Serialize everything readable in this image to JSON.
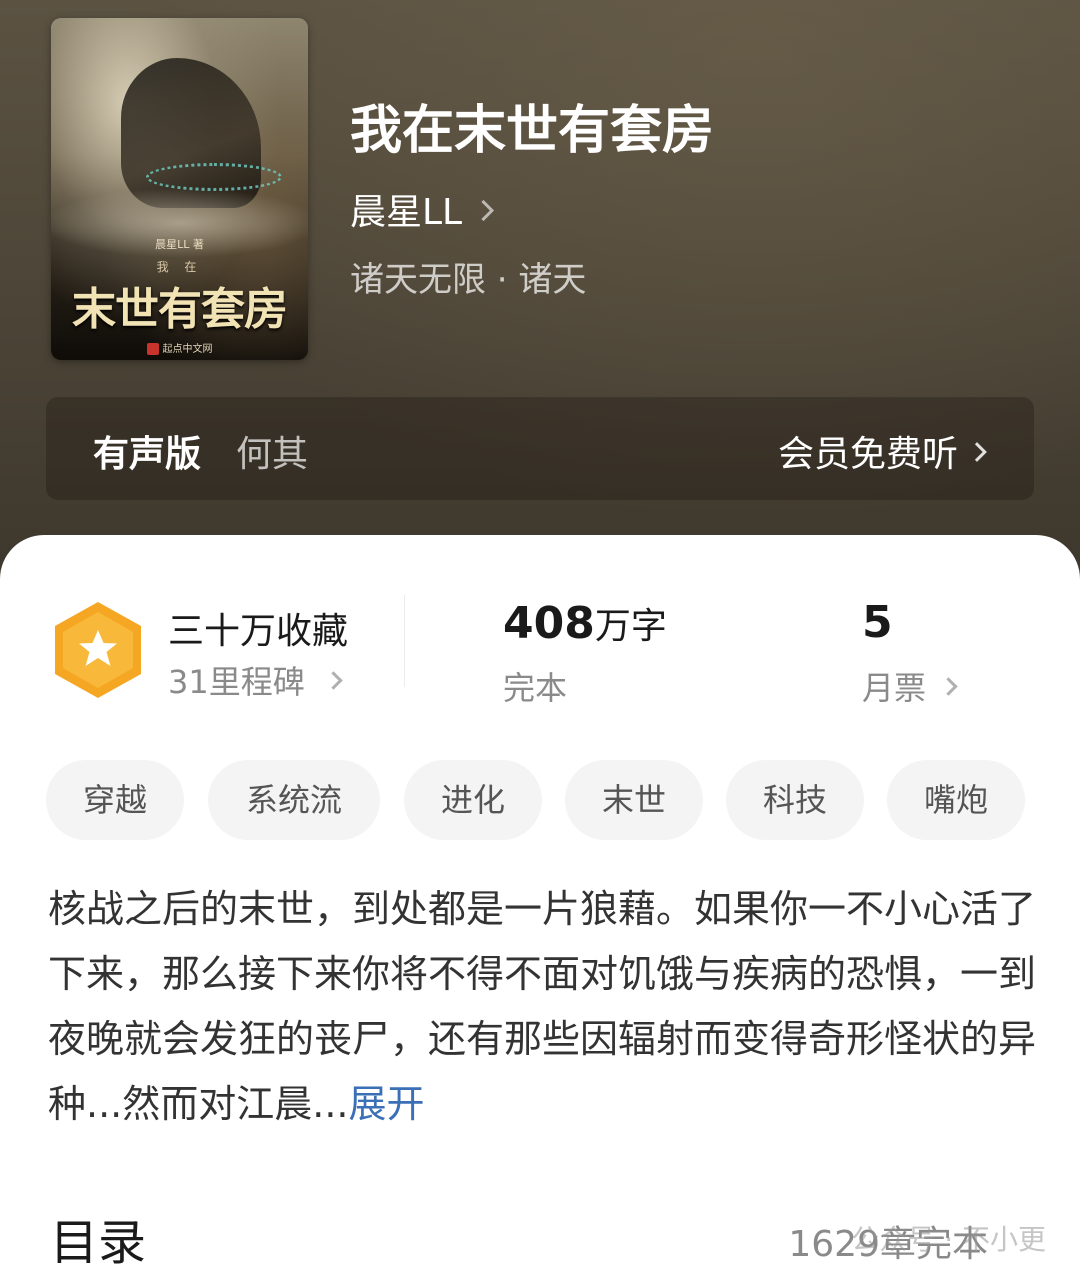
{
  "book": {
    "title": "我在末世有套房",
    "author": "晨星LL",
    "category": "诸天无限 · 诸天"
  },
  "cover": {
    "title": "末世有套房",
    "subtitle": "我 在",
    "author": "晨星LL 著",
    "publisher": "起点中文网"
  },
  "audio": {
    "label": "有声版",
    "narrator": "何其",
    "cta": "会员免费听"
  },
  "stats": {
    "collect_title": "三十万收藏",
    "milestone": "31里程碑",
    "word_count": "408",
    "word_unit": "万字",
    "status": "完本",
    "monthly_ticket_count": "5",
    "monthly_ticket_label": "月票"
  },
  "tags": [
    "穿越",
    "系统流",
    "进化",
    "末世",
    "科技",
    "嘴炮"
  ],
  "synopsis": {
    "text": "核战之后的末世，到处都是一片狼藉。如果你一不小心活了下来，那么接下来你将不得不面对饥饿与疾病的恐惧，一到夜晚就会发狂的丧尸，还有那些因辐射而变得奇形怪状的异种...然而对江晨...",
    "expand_label": "展开"
  },
  "toc": {
    "title": "目录",
    "meta": "1629章完本"
  },
  "watermark": "公众号 · 不小更",
  "colors": {
    "header_bg": "#4e4638",
    "badge_orange": "#f5a623",
    "link_blue": "#3b6fb6"
  }
}
